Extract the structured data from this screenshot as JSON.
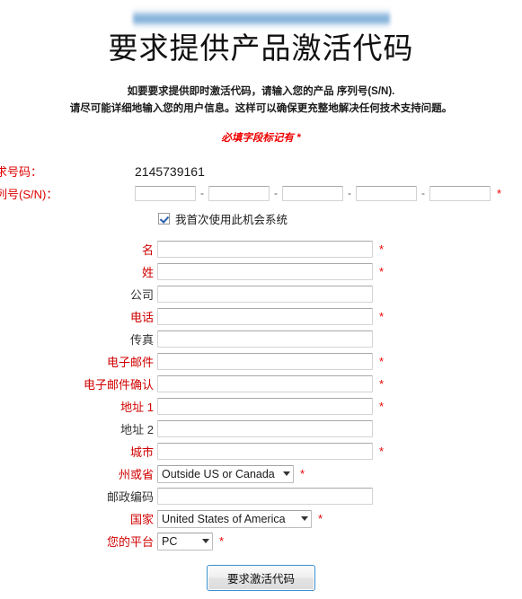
{
  "header": {
    "title": "要求提供产品激活代码",
    "redacted_banner": "redacted-logo-bar",
    "intro_line1_a": "如要要求提供即时激活代码，请输入您的产品 ",
    "intro_line1_b": "序列号(S/N).",
    "intro_line2": "请尽可能详细地输入您的用户信息。这样可以确保更充整地解决任何技术支持问题。",
    "required_note": "必填字段标记有 *"
  },
  "top_info": {
    "request_number_label": "请求号码：",
    "request_number_value": "2145739161",
    "serial_label": "序列号(S/N)：",
    "serial_segments": [
      "",
      "",
      "",
      "",
      ""
    ],
    "serial_separator": "-",
    "serial_required_mark": "*",
    "checkbox_label": "我首次使用此机会系统",
    "checkbox_checked": true
  },
  "form": {
    "rows": [
      {
        "label": "名",
        "type": "text",
        "value": "",
        "required": true,
        "star": "*"
      },
      {
        "label": "姓",
        "type": "text",
        "value": "",
        "required": true,
        "star": "*"
      },
      {
        "label": "公司",
        "type": "text",
        "value": "",
        "required": false,
        "star": ""
      },
      {
        "label": "电话",
        "type": "text",
        "value": "",
        "required": true,
        "star": "*"
      },
      {
        "label": "传真",
        "type": "text",
        "value": "",
        "required": false,
        "star": ""
      },
      {
        "label": "电子邮件",
        "type": "text",
        "value": "",
        "required": true,
        "star": "*"
      },
      {
        "label": "电子邮件确认",
        "type": "text",
        "value": "",
        "required": true,
        "star": "*"
      },
      {
        "label": "地址 1",
        "type": "text",
        "value": "",
        "required": true,
        "star": "*"
      },
      {
        "label": "地址 2",
        "type": "text",
        "value": "",
        "required": false,
        "star": ""
      },
      {
        "label": "城市",
        "type": "text",
        "value": "",
        "required": true,
        "star": "*"
      },
      {
        "label": "州或省",
        "type": "select",
        "value": "Outside US or Canada",
        "required": true,
        "star": "*"
      },
      {
        "label": "邮政编码",
        "type": "text",
        "value": "",
        "required": false,
        "star": ""
      },
      {
        "label": "国家",
        "type": "select",
        "value": "United States of America",
        "required": true,
        "star": "*"
      },
      {
        "label": "您的平台",
        "type": "select",
        "value": "PC",
        "required": true,
        "star": "*"
      }
    ]
  },
  "submit": {
    "label": "要求激活代码"
  },
  "colors": {
    "required_red": "#d00000",
    "star_red": "#ee0000",
    "button_border_blue": "#3a8fd0",
    "redact_blue": "#78aad6"
  }
}
